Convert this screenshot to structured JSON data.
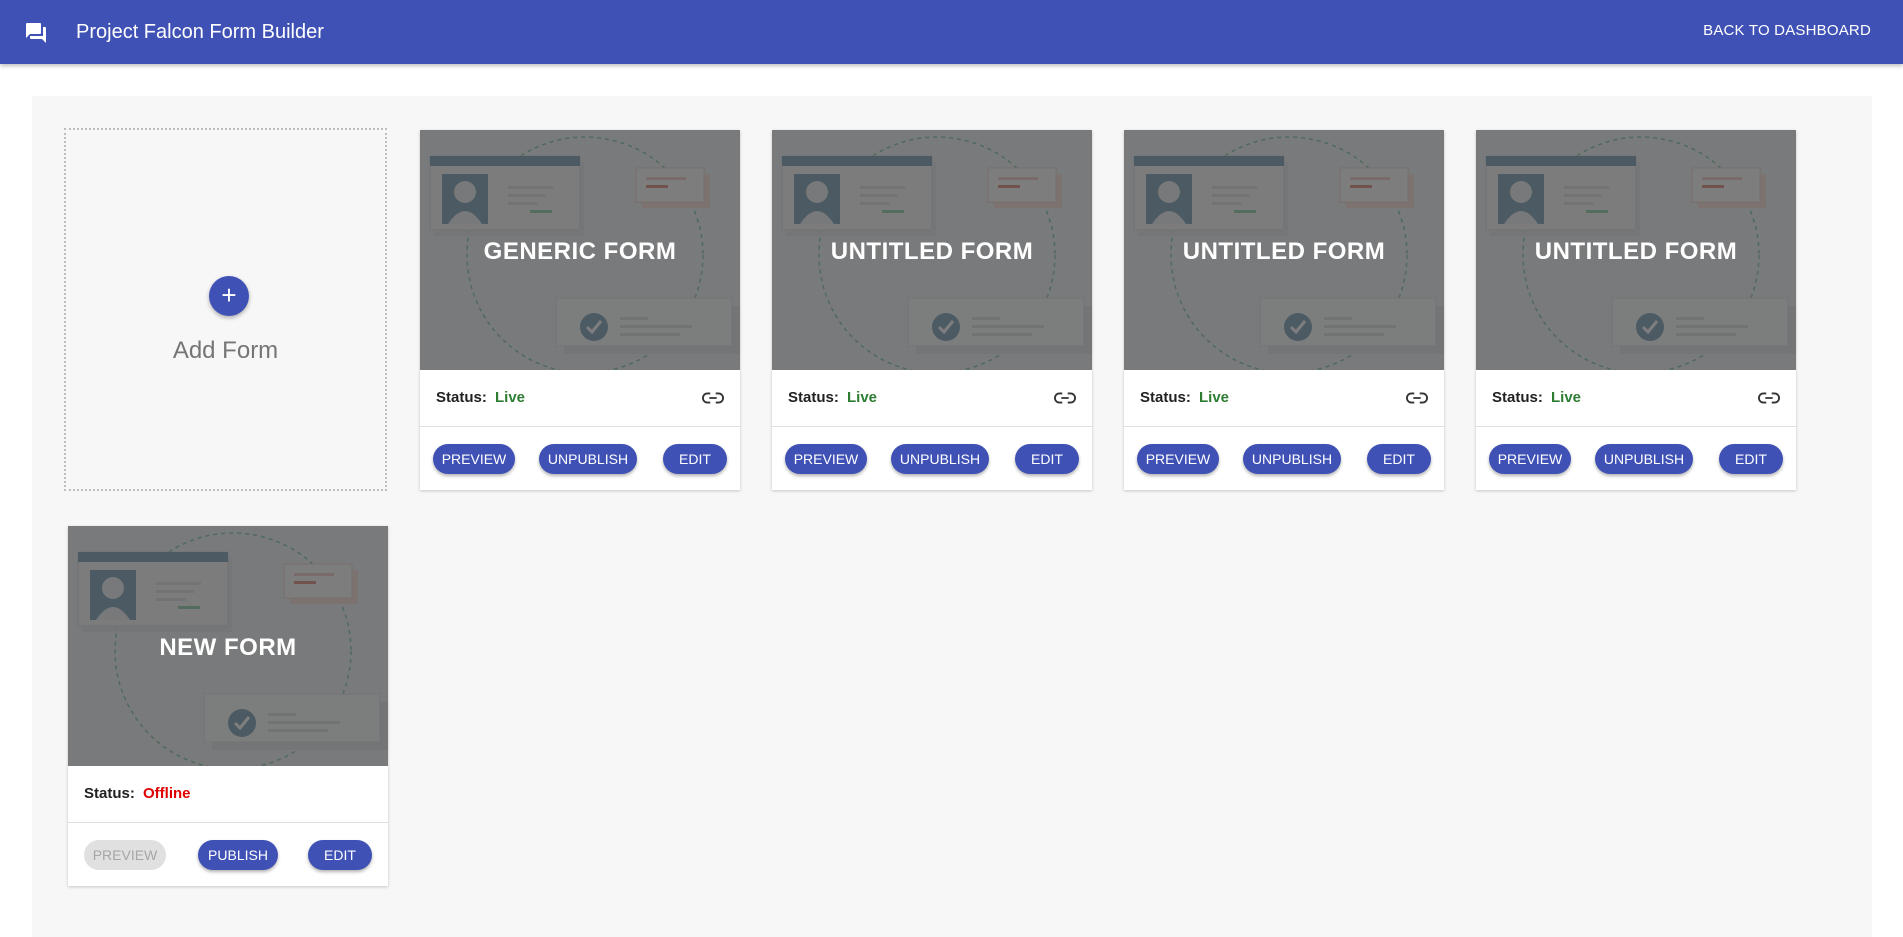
{
  "appbar": {
    "title": "Project Falcon Form Builder",
    "back_label": "BACK TO DASHBOARD",
    "logo_icon": "forum-icon",
    "color": "#3f51b5"
  },
  "add_form": {
    "label": "Add Form",
    "icon": "+"
  },
  "status_label": "Status:",
  "forms": [
    {
      "name": "GENERIC FORM",
      "status": "Live",
      "buttons": [
        "PREVIEW",
        "UNPUBLISH",
        "EDIT"
      ]
    },
    {
      "name": "UNTITLED FORM",
      "status": "Live",
      "buttons": [
        "PREVIEW",
        "UNPUBLISH",
        "EDIT"
      ]
    },
    {
      "name": "UNTITLED FORM",
      "status": "Live",
      "buttons": [
        "PREVIEW",
        "UNPUBLISH",
        "EDIT"
      ]
    },
    {
      "name": "UNTITLED FORM",
      "status": "Live",
      "buttons": [
        "PREVIEW",
        "UNPUBLISH",
        "EDIT"
      ]
    },
    {
      "name": "NEW FORM",
      "status": "Offline",
      "buttons": [
        "PREVIEW",
        "PUBLISH",
        "EDIT"
      ]
    }
  ],
  "colors": {
    "live": "#2e7d32",
    "offline": "#e00000",
    "button": "#3f51b5"
  }
}
